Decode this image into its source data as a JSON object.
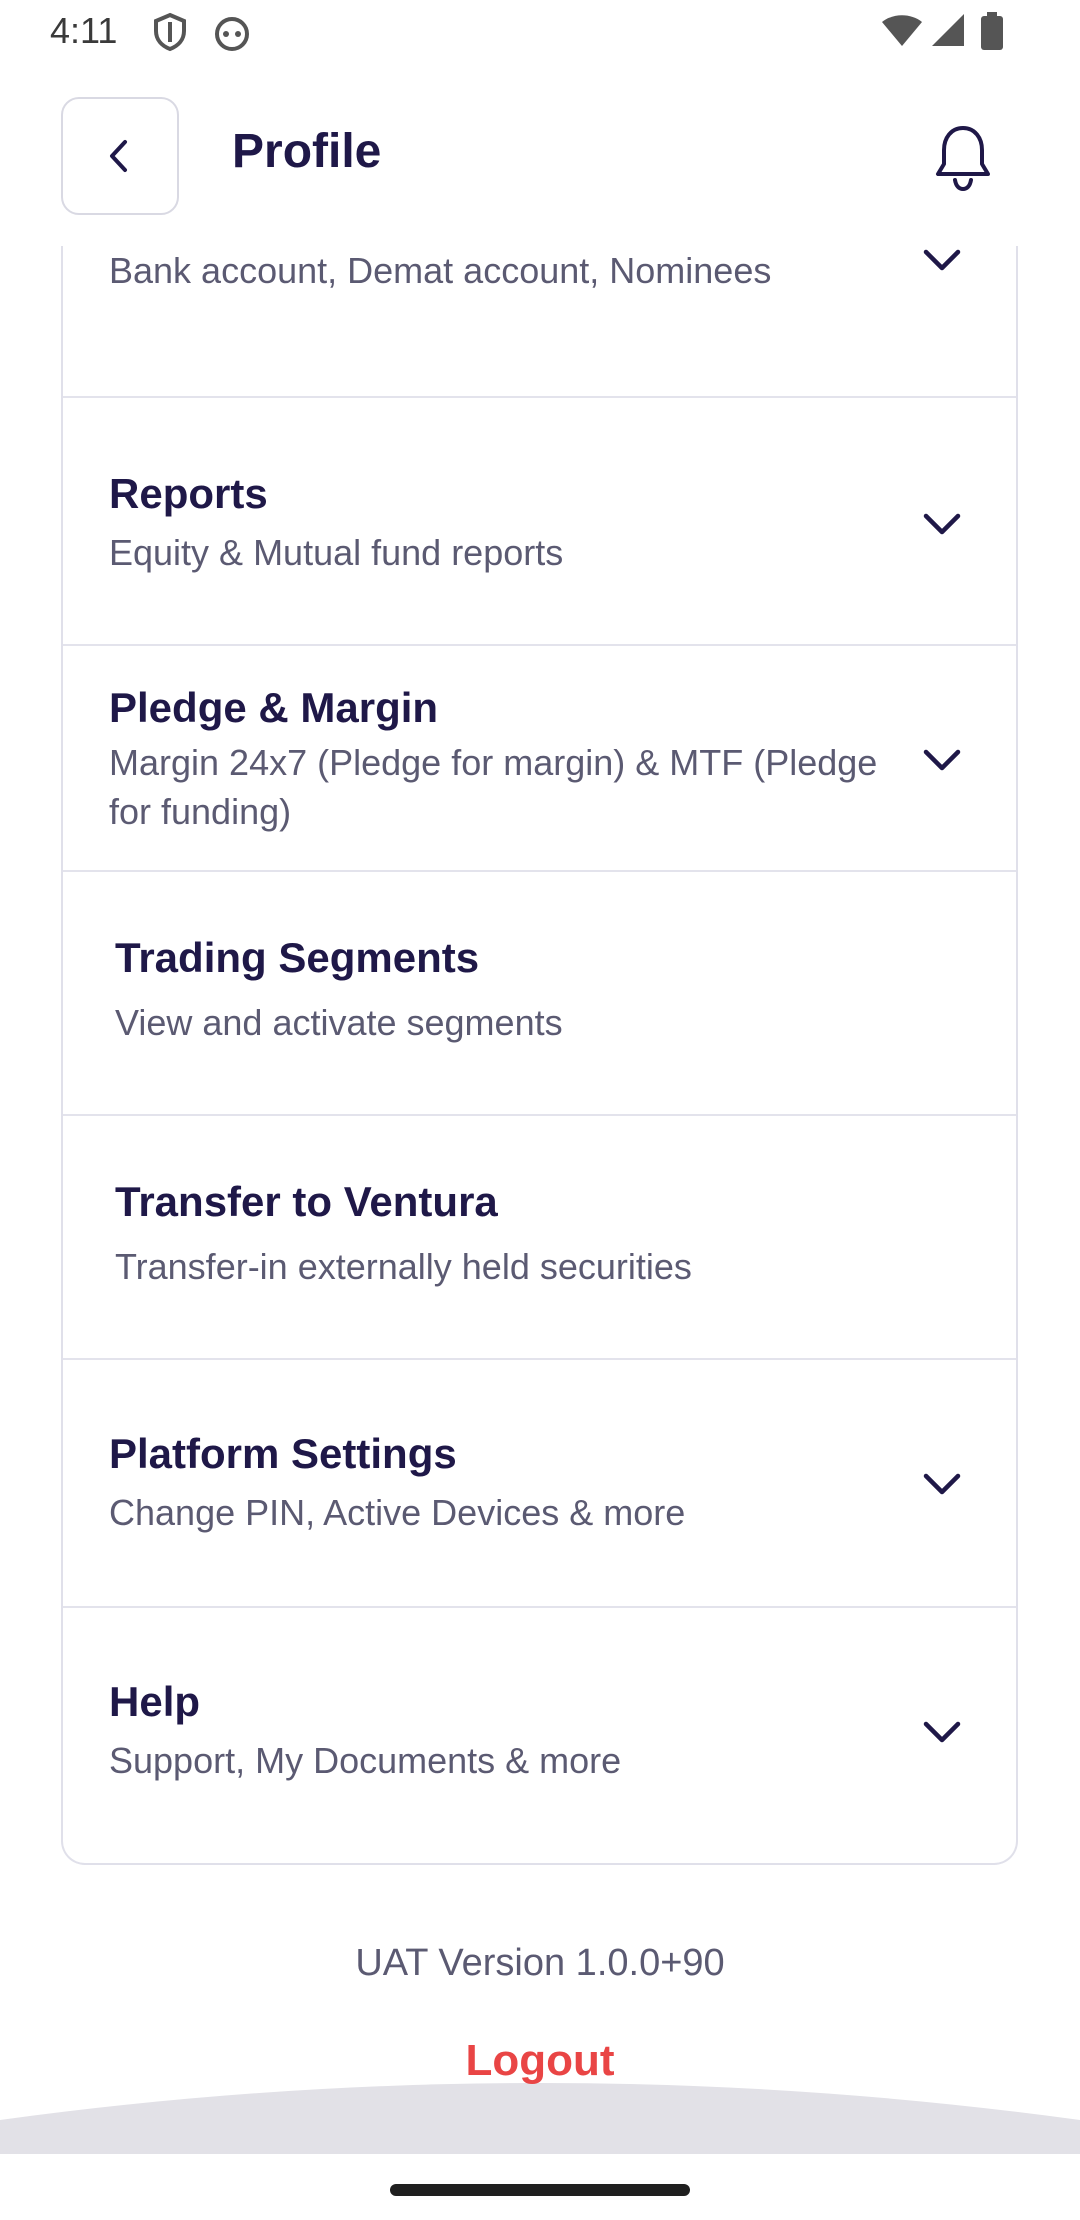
{
  "status_bar": {
    "time": "4:11"
  },
  "header": {
    "title": "Profile"
  },
  "menu": [
    {
      "title": "",
      "subtitle": "Bank account, Demat account, Nominees"
    },
    {
      "title": "Reports",
      "subtitle": "Equity & Mutual fund reports"
    },
    {
      "title": "Pledge & Margin",
      "subtitle": "Margin 24x7 (Pledge for margin) & MTF (Pledge for funding)"
    },
    {
      "title": "Trading Segments",
      "subtitle": "View and activate segments"
    },
    {
      "title": "Transfer to Ventura",
      "subtitle": "Transfer-in externally held securities"
    },
    {
      "title": "Platform Settings",
      "subtitle": "Change PIN, Active Devices & more"
    },
    {
      "title": "Help",
      "subtitle": "Support, My Documents & more"
    }
  ],
  "footer": {
    "version": "UAT Version 1.0.0+90",
    "logout_label": "Logout"
  },
  "colors": {
    "primary_text": "#1f1848",
    "secondary_text": "#5b5a72",
    "logout": "#e94545",
    "divider": "#e3e3ec"
  },
  "icons": [
    "back-arrow-icon",
    "bell-icon",
    "chevron-down-icon",
    "wifi-icon",
    "signal-icon",
    "battery-icon"
  ]
}
